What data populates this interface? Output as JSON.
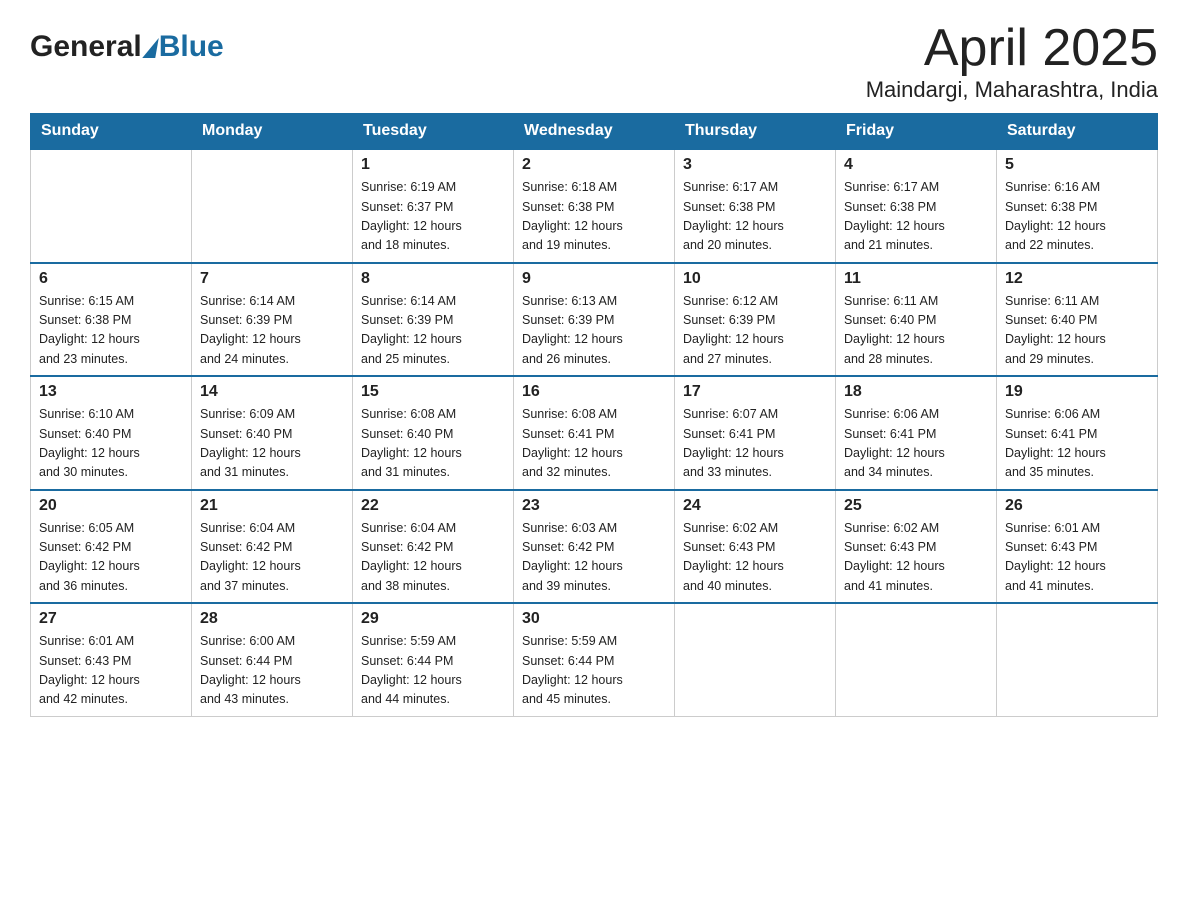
{
  "header": {
    "logo_general": "General",
    "logo_blue": "Blue",
    "title": "April 2025",
    "subtitle": "Maindargi, Maharashtra, India"
  },
  "days_of_week": [
    "Sunday",
    "Monday",
    "Tuesday",
    "Wednesday",
    "Thursday",
    "Friday",
    "Saturday"
  ],
  "weeks": [
    [
      {
        "day": "",
        "info": ""
      },
      {
        "day": "",
        "info": ""
      },
      {
        "day": "1",
        "info": "Sunrise: 6:19 AM\nSunset: 6:37 PM\nDaylight: 12 hours\nand 18 minutes."
      },
      {
        "day": "2",
        "info": "Sunrise: 6:18 AM\nSunset: 6:38 PM\nDaylight: 12 hours\nand 19 minutes."
      },
      {
        "day": "3",
        "info": "Sunrise: 6:17 AM\nSunset: 6:38 PM\nDaylight: 12 hours\nand 20 minutes."
      },
      {
        "day": "4",
        "info": "Sunrise: 6:17 AM\nSunset: 6:38 PM\nDaylight: 12 hours\nand 21 minutes."
      },
      {
        "day": "5",
        "info": "Sunrise: 6:16 AM\nSunset: 6:38 PM\nDaylight: 12 hours\nand 22 minutes."
      }
    ],
    [
      {
        "day": "6",
        "info": "Sunrise: 6:15 AM\nSunset: 6:38 PM\nDaylight: 12 hours\nand 23 minutes."
      },
      {
        "day": "7",
        "info": "Sunrise: 6:14 AM\nSunset: 6:39 PM\nDaylight: 12 hours\nand 24 minutes."
      },
      {
        "day": "8",
        "info": "Sunrise: 6:14 AM\nSunset: 6:39 PM\nDaylight: 12 hours\nand 25 minutes."
      },
      {
        "day": "9",
        "info": "Sunrise: 6:13 AM\nSunset: 6:39 PM\nDaylight: 12 hours\nand 26 minutes."
      },
      {
        "day": "10",
        "info": "Sunrise: 6:12 AM\nSunset: 6:39 PM\nDaylight: 12 hours\nand 27 minutes."
      },
      {
        "day": "11",
        "info": "Sunrise: 6:11 AM\nSunset: 6:40 PM\nDaylight: 12 hours\nand 28 minutes."
      },
      {
        "day": "12",
        "info": "Sunrise: 6:11 AM\nSunset: 6:40 PM\nDaylight: 12 hours\nand 29 minutes."
      }
    ],
    [
      {
        "day": "13",
        "info": "Sunrise: 6:10 AM\nSunset: 6:40 PM\nDaylight: 12 hours\nand 30 minutes."
      },
      {
        "day": "14",
        "info": "Sunrise: 6:09 AM\nSunset: 6:40 PM\nDaylight: 12 hours\nand 31 minutes."
      },
      {
        "day": "15",
        "info": "Sunrise: 6:08 AM\nSunset: 6:40 PM\nDaylight: 12 hours\nand 31 minutes."
      },
      {
        "day": "16",
        "info": "Sunrise: 6:08 AM\nSunset: 6:41 PM\nDaylight: 12 hours\nand 32 minutes."
      },
      {
        "day": "17",
        "info": "Sunrise: 6:07 AM\nSunset: 6:41 PM\nDaylight: 12 hours\nand 33 minutes."
      },
      {
        "day": "18",
        "info": "Sunrise: 6:06 AM\nSunset: 6:41 PM\nDaylight: 12 hours\nand 34 minutes."
      },
      {
        "day": "19",
        "info": "Sunrise: 6:06 AM\nSunset: 6:41 PM\nDaylight: 12 hours\nand 35 minutes."
      }
    ],
    [
      {
        "day": "20",
        "info": "Sunrise: 6:05 AM\nSunset: 6:42 PM\nDaylight: 12 hours\nand 36 minutes."
      },
      {
        "day": "21",
        "info": "Sunrise: 6:04 AM\nSunset: 6:42 PM\nDaylight: 12 hours\nand 37 minutes."
      },
      {
        "day": "22",
        "info": "Sunrise: 6:04 AM\nSunset: 6:42 PM\nDaylight: 12 hours\nand 38 minutes."
      },
      {
        "day": "23",
        "info": "Sunrise: 6:03 AM\nSunset: 6:42 PM\nDaylight: 12 hours\nand 39 minutes."
      },
      {
        "day": "24",
        "info": "Sunrise: 6:02 AM\nSunset: 6:43 PM\nDaylight: 12 hours\nand 40 minutes."
      },
      {
        "day": "25",
        "info": "Sunrise: 6:02 AM\nSunset: 6:43 PM\nDaylight: 12 hours\nand 41 minutes."
      },
      {
        "day": "26",
        "info": "Sunrise: 6:01 AM\nSunset: 6:43 PM\nDaylight: 12 hours\nand 41 minutes."
      }
    ],
    [
      {
        "day": "27",
        "info": "Sunrise: 6:01 AM\nSunset: 6:43 PM\nDaylight: 12 hours\nand 42 minutes."
      },
      {
        "day": "28",
        "info": "Sunrise: 6:00 AM\nSunset: 6:44 PM\nDaylight: 12 hours\nand 43 minutes."
      },
      {
        "day": "29",
        "info": "Sunrise: 5:59 AM\nSunset: 6:44 PM\nDaylight: 12 hours\nand 44 minutes."
      },
      {
        "day": "30",
        "info": "Sunrise: 5:59 AM\nSunset: 6:44 PM\nDaylight: 12 hours\nand 45 minutes."
      },
      {
        "day": "",
        "info": ""
      },
      {
        "day": "",
        "info": ""
      },
      {
        "day": "",
        "info": ""
      }
    ]
  ]
}
